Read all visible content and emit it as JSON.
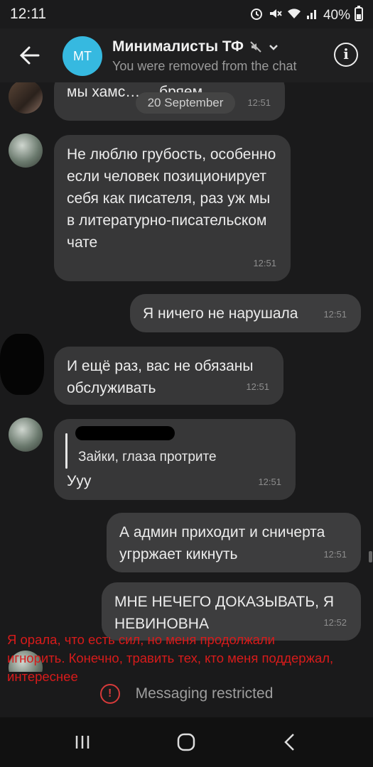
{
  "status_bar": {
    "time": "12:11",
    "battery": "40%",
    "icons": [
      "alarm-icon",
      "mute-icon",
      "wifi-icon",
      "signal-icon",
      "battery-icon"
    ]
  },
  "header": {
    "avatar_initials": "MT",
    "avatar_color": "#36b9e0",
    "title": "Минималисты ТФ",
    "subtitle": "You were removed from the chat",
    "icons": [
      "back-arrow-icon",
      "muted-icon",
      "chevron-down-icon",
      "info-icon"
    ]
  },
  "chat": {
    "date_separator": "20 September",
    "messages": [
      {
        "text": "мы хамс… …бряем",
        "time": "12:51"
      },
      {
        "text": "Не люблю грубость, особенно если человек позиционирует себя как писателя, раз уж мы в литературно-писательском чате",
        "time": "12:51"
      },
      {
        "text": "Я ничего не нарушала",
        "time": "12:51"
      },
      {
        "text": "И ещё раз, вас не обязаны обслуживать",
        "time": "12:51"
      },
      {
        "reply_quote": "Зайки, глаза протрите",
        "text": "Ууу",
        "time": "12:51"
      },
      {
        "text": "А админ приходит и сничерта угрржает кикнуть",
        "time": "12:51"
      },
      {
        "text": "МНЕ НЕЧЕГО ДОКАЗЫВАТЬ, Я НЕВИНОВНА",
        "time": "12:52"
      }
    ]
  },
  "annotation": "Я орала, что есть сил, но меня продолжали игнорить. Конечно, травить тех, кто меня поддержал, интереснее",
  "footer": {
    "restricted_label": "Messaging restricted",
    "accent": "#d63a3a"
  },
  "nav_bar": {
    "icons": [
      "recent-apps-icon",
      "home-icon",
      "back-icon"
    ]
  }
}
